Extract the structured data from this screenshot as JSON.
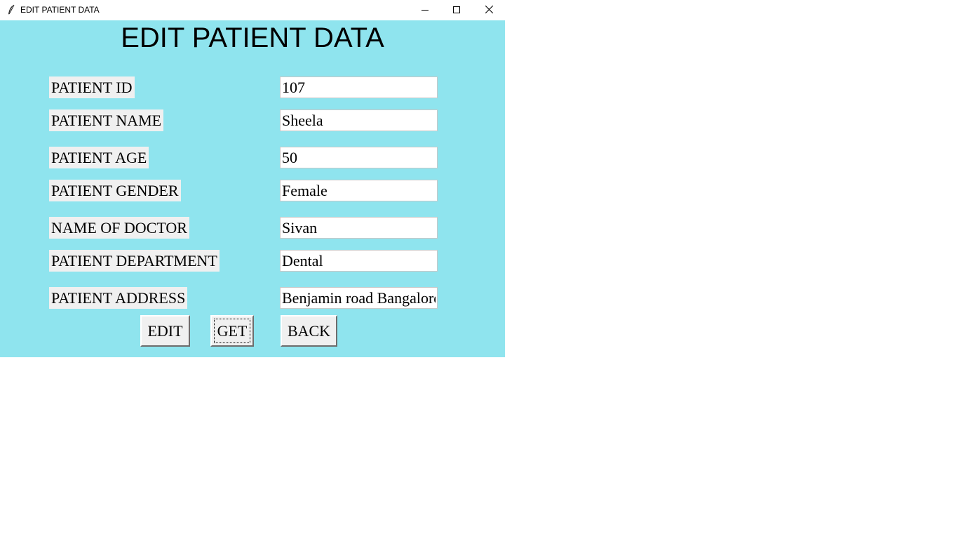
{
  "window": {
    "title": "EDIT PATIENT DATA",
    "controls": {
      "minimize_icon": "minimize-icon",
      "maximize_icon": "maximize-icon",
      "close_icon": "close-icon"
    }
  },
  "form": {
    "heading": "EDIT PATIENT DATA",
    "background_color": "#8fe4ee",
    "fields": [
      {
        "label": "PATIENT ID",
        "value": "107"
      },
      {
        "label": "PATIENT NAME",
        "value": "Sheela"
      },
      {
        "label": "PATIENT AGE",
        "value": "50"
      },
      {
        "label": "PATIENT GENDER",
        "value": "Female"
      },
      {
        "label": "NAME OF DOCTOR",
        "value": "Sivan"
      },
      {
        "label": "PATIENT DEPARTMENT",
        "value": "Dental"
      },
      {
        "label": "PATIENT ADDRESS",
        "value": "Benjamin road Bangalore"
      }
    ],
    "buttons": {
      "edit": "EDIT",
      "get": "GET",
      "back": "BACK"
    }
  }
}
